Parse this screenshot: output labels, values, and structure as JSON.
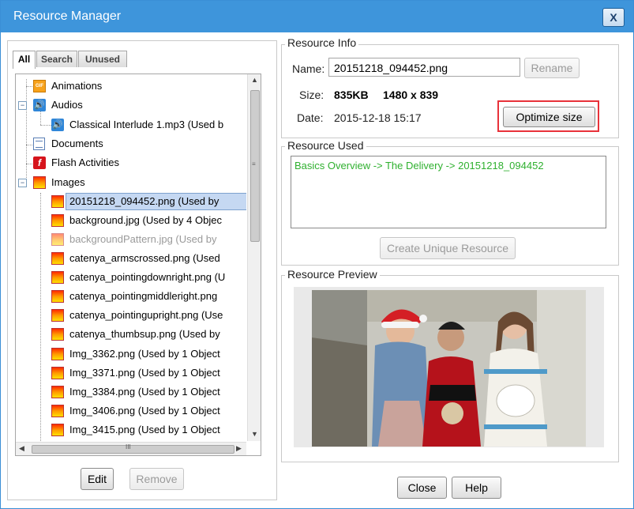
{
  "window": {
    "title": "Resource Manager",
    "close_label": "X"
  },
  "tabs": [
    {
      "label": "All"
    },
    {
      "label": "Search"
    },
    {
      "label": "Unused"
    }
  ],
  "tree": {
    "animations": "Animations",
    "audios": "Audios",
    "audio_item": "Classical Interlude 1.mp3    (Used b",
    "documents": "Documents",
    "flash": "Flash Activities",
    "images": "Images",
    "image_items": [
      "20151218_094452.png    (Used by",
      "background.jpg    (Used by 4 Objec",
      "backgroundPattern.jpg    (Used by",
      "catenya_armscrossed.png    (Used",
      "catenya_pointingdownright.png    (U",
      "catenya_pointingmiddleright.png",
      "catenya_pointingupright.png    (Use",
      "catenya_thumbsup.png    (Used by",
      "Img_3362.png    (Used by 1 Object",
      "Img_3371.png    (Used by 1 Object",
      "Img_3384.png    (Used by 1 Object",
      "Img_3406.png    (Used by 1 Object",
      "Img_3415.png    (Used by 1 Object"
    ],
    "scroll_h_thumb_label": "III"
  },
  "left_buttons": {
    "edit": "Edit",
    "remove": "Remove"
  },
  "resource_info": {
    "legend": "Resource Info",
    "name_label": "Name:",
    "name_value": "20151218_094452.png",
    "rename": "Rename",
    "size_label": "Size:",
    "size_value": "835KB",
    "dims_value": "1480 x 839",
    "date_label": "Date:",
    "date_value": "2015-12-18 15:17",
    "optimize": "Optimize size"
  },
  "resource_used": {
    "legend": "Resource Used",
    "entry": "Basics Overview -> The Delivery -> 20151218_094452",
    "create_unique": "Create Unique Resource"
  },
  "resource_preview": {
    "legend": "Resource Preview"
  },
  "footer": {
    "close": "Close",
    "help": "Help"
  },
  "colors": {
    "title_bar": "#3e95db",
    "highlight": "#e8323a",
    "used_text": "#2fb02f",
    "selection": "#c5d8f2"
  }
}
